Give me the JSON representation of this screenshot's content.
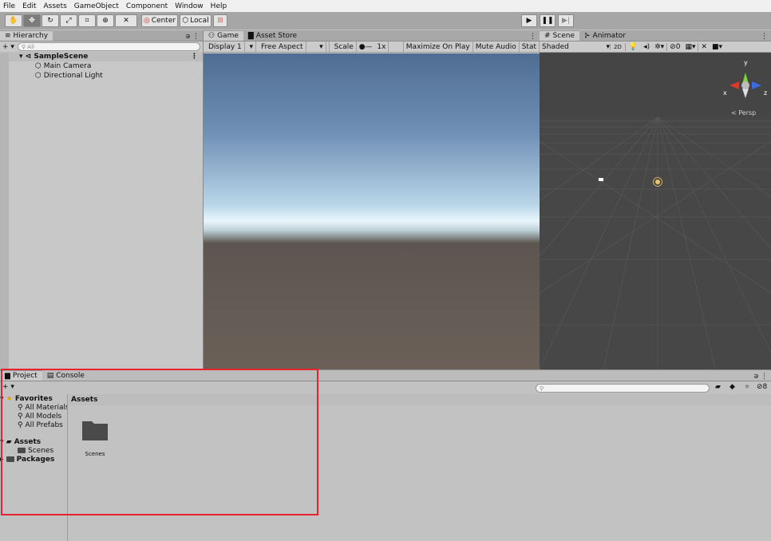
{
  "menu": [
    "File",
    "Edit",
    "Assets",
    "GameObject",
    "Component",
    "Window",
    "Help"
  ],
  "toolbar": {
    "pivot_label": "Center",
    "space_label": "Local"
  },
  "hierarchy": {
    "tab_label": "Hierarchy",
    "search_placeholder": "All",
    "scene_name": "SampleScene",
    "items": [
      "Main Camera",
      "Directional Light"
    ]
  },
  "game": {
    "tabs": [
      "Game",
      "Asset Store"
    ],
    "display": "Display 1",
    "aspect": "Free Aspect",
    "scale_label": "Scale",
    "scale_value": "1x",
    "maximize": "Maximize On Play",
    "mute": "Mute Audio",
    "stats": "Stat"
  },
  "scene": {
    "tabs": [
      "Scene",
      "Animator"
    ],
    "shading": "Shaded",
    "mode_2d": "2D",
    "gizmo_count": "0",
    "persp": "< Persp",
    "axis_y": "y",
    "axis_x": "x",
    "axis_z": "z"
  },
  "project": {
    "tabs": [
      "Project",
      "Console"
    ],
    "favorites_label": "Favorites",
    "favorites": [
      "All Materials",
      "All Models",
      "All Prefabs"
    ],
    "assets_label": "Assets",
    "assets_children": [
      "Scenes"
    ],
    "packages_label": "Packages",
    "breadcrumb": "Assets",
    "grid_items": [
      "Scenes"
    ],
    "hidden_count": "8"
  },
  "colors": {
    "highlight": "#e8232b"
  }
}
